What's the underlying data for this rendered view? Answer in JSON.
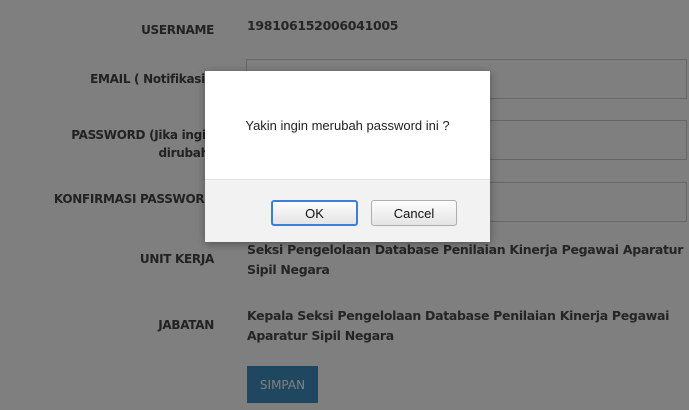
{
  "form": {
    "username_label": "USERNAME",
    "username_value": "198106152006041005",
    "email_label": "EMAIL ( Notifikasi )",
    "password_label_line1": "PASSWORD (Jika ingin",
    "password_label_line2": "dirubah)",
    "confirm_label": "KONFIRMASI PASSWORD",
    "unit_label": "UNIT KERJA",
    "unit_value_line1": "Seksi Pengelolaan Database Penilaian Kinerja Pegawai Aparatur",
    "unit_value_line2": "Sipil Negara",
    "jabatan_label": "JABATAN",
    "jabatan_value_line1": "Kepala Seksi Pengelolaan Database Penilaian Kinerja Pegawai",
    "jabatan_value_line2": "Aparatur Sipil Negara",
    "save_label": "SIMPAN"
  },
  "dialog": {
    "message": "Yakin ingin merubah password ini ?",
    "ok_label": "OK",
    "cancel_label": "Cancel"
  },
  "colors": {
    "save_button": "#3f8fc0",
    "overlay": "rgba(0,0,0,0.5)",
    "ok_focus": "#3c7fd9"
  }
}
